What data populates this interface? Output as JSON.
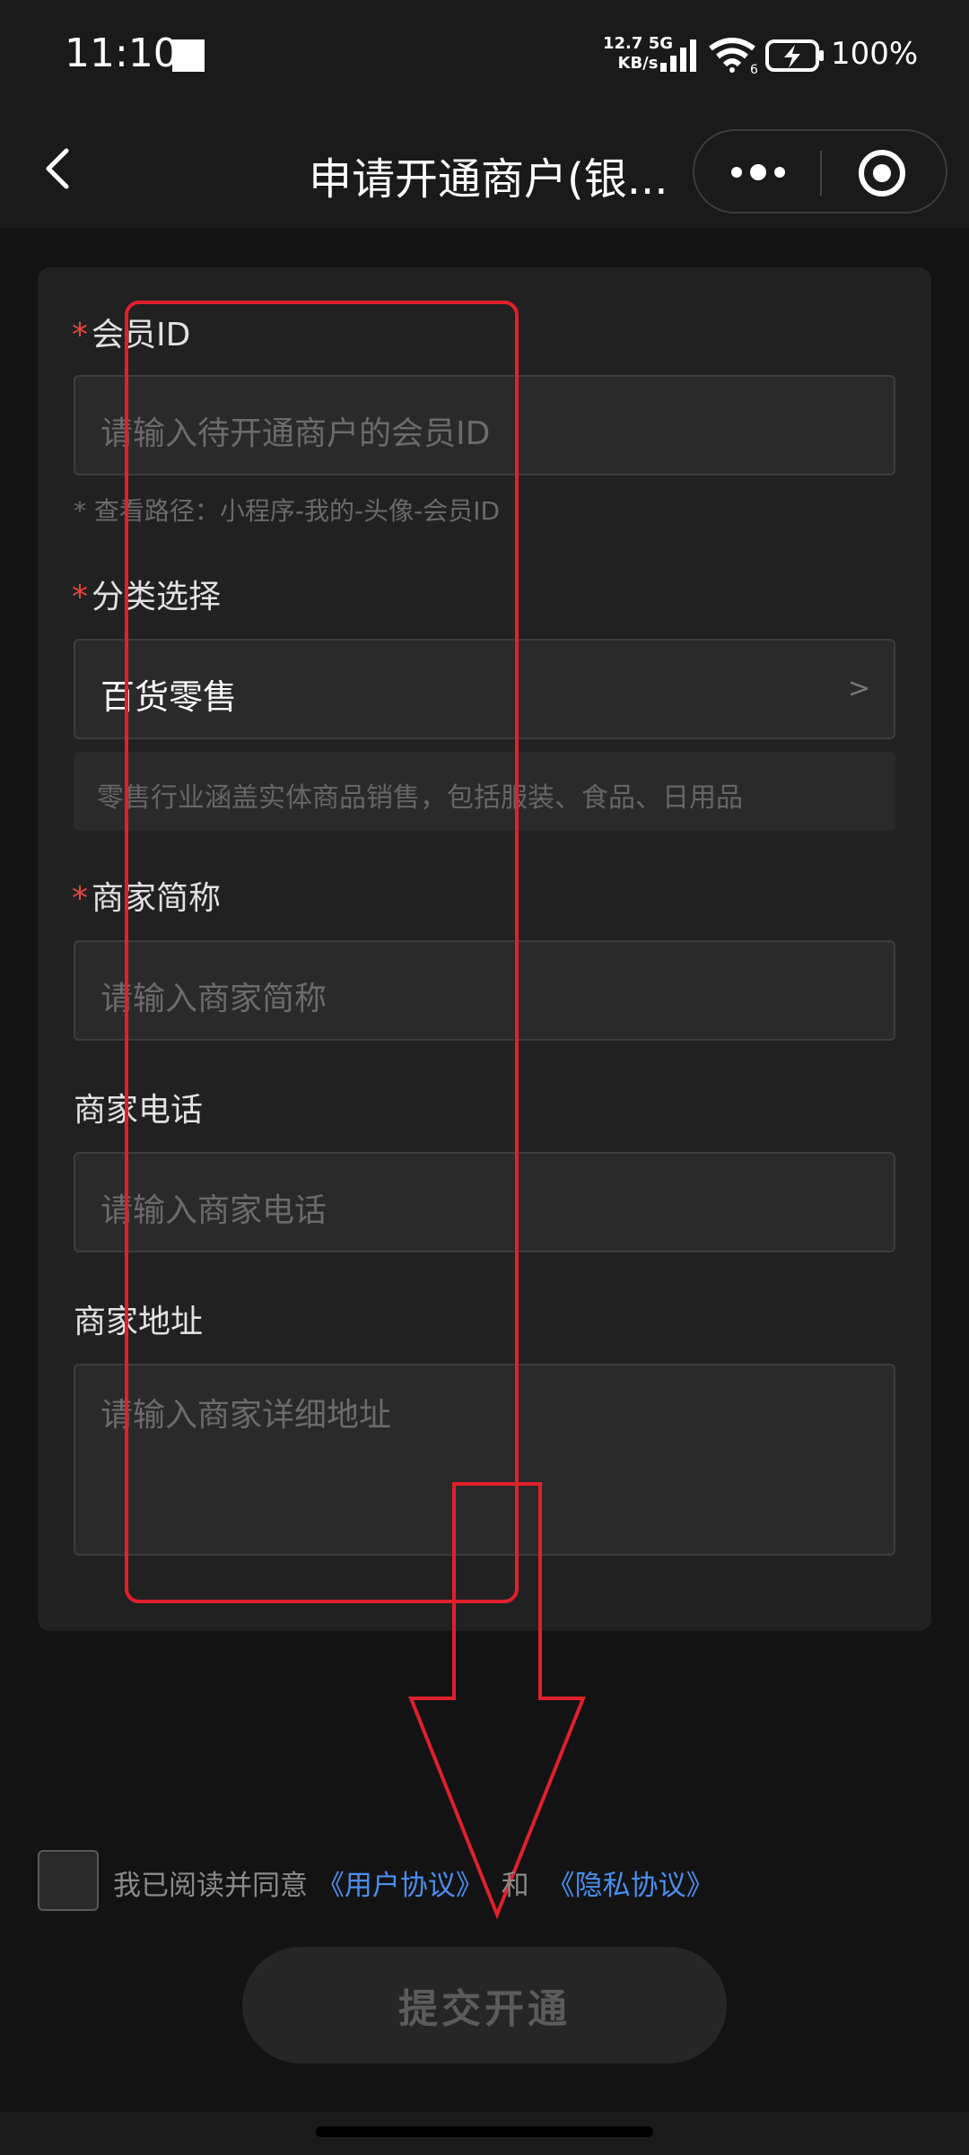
{
  "status_bar": {
    "time": "11:10",
    "speed_value": "12.7",
    "speed_unit": "KB/s",
    "network": "5G",
    "wifi_level": "6",
    "battery": "100%"
  },
  "nav": {
    "title": "申请开通商户(银..."
  },
  "form": {
    "member_id": {
      "required_mark": "*",
      "label": "会员ID",
      "placeholder": "请输入待开通商户的会员ID",
      "hint": "* 查看路径：小程序-我的-头像-会员ID"
    },
    "category": {
      "required_mark": "*",
      "label": "分类选择",
      "value": "百货零售",
      "chevron": ">",
      "description": "零售行业涵盖实体商品销售，包括服装、食品、日用品"
    },
    "short_name": {
      "required_mark": "*",
      "label": "商家简称",
      "placeholder": "请输入商家简称"
    },
    "phone": {
      "label": "商家电话",
      "placeholder": "请输入商家电话"
    },
    "address": {
      "label": "商家地址",
      "placeholder": "请输入商家详细地址"
    }
  },
  "agreement": {
    "prefix": "我已阅读并同意",
    "user_agreement": "《用户协议》",
    "and": "和",
    "privacy_agreement": "《隐私协议》"
  },
  "submit_label": "提交开通",
  "colors": {
    "background": "#131313",
    "card": "#212121",
    "required": "#e5453e",
    "link": "#4a8ff0",
    "annotation": "#e0202c"
  }
}
